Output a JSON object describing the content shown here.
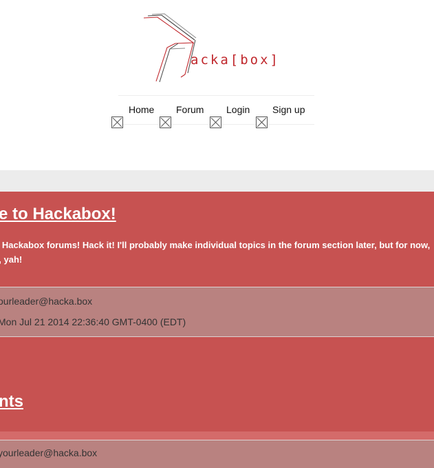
{
  "logo": {
    "text": "acka[box]",
    "color": "#c0282d"
  },
  "nav": {
    "items": [
      {
        "label": "Home",
        "icon": "broken-image-icon"
      },
      {
        "label": "Forum",
        "icon": "broken-image-icon"
      },
      {
        "label": "Login",
        "icon": "broken-image-icon"
      },
      {
        "label": "Sign up",
        "icon": "broken-image-icon"
      }
    ]
  },
  "posts": [
    {
      "title": "e to Hackabox!",
      "body_line1": "e Hackabox forums! Hack it! I'll probably make individual topics in the forum section later, but for now,",
      "body_line2": "y, yah!",
      "author": "ourleader@hacka.box",
      "date": "Mon Jul 21 2014 22:36:40 GMT-0400 (EDT)"
    },
    {
      "title": "nts",
      "author": "yourleader@hacka.box"
    }
  ],
  "colors": {
    "card": "#c75251",
    "meta": "#b98280",
    "band": "#ececec"
  }
}
